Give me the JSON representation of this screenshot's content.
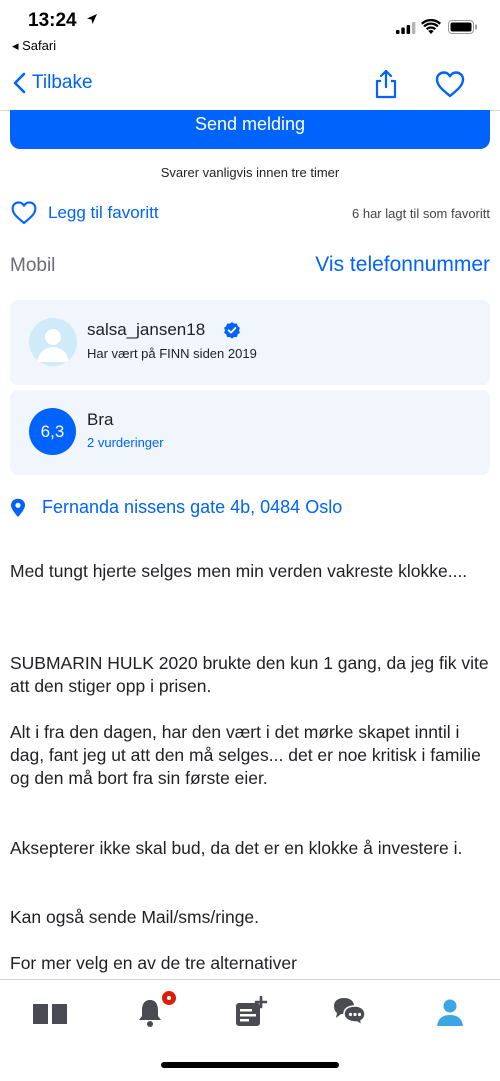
{
  "status": {
    "time": "13:24",
    "back_app": "◂ Safari"
  },
  "nav": {
    "back_label": "Tilbake"
  },
  "contact": {
    "send_label": "Send melding",
    "reply_note": "Svarer vanligvis innen tre timer",
    "favorite_label": "Legg til favoritt",
    "favorite_count": "6 har lagt til som favoritt",
    "phone_label": "Mobil",
    "phone_link": "Vis telefonnummer"
  },
  "seller": {
    "username": "salsa_jansen18",
    "since": "Har vært på FINN siden 2019",
    "score": "6,3",
    "rating_label": "Bra",
    "rating_count": "2 vurderinger"
  },
  "address": "Fernanda nissens gate 4b, 0484 Oslo",
  "description": [
    "Med tungt hjerte selges men min verden vakreste klokke....",
    "SUBMARIN HULK 2020 brukte den kun 1 gang, da jeg fik vite att den stiger opp i prisen.",
    "Alt i fra den dagen, har den vært i det mørke skapet inntil i dag, fant jeg ut att den må selges... det er noe kritisk i familie og den må bort fra sin første eier.",
    "Aksepterer ikke skal bud, da det er en klokke å investere i.",
    "Kan også sende Mail/sms/ringe.",
    "For mer velg en av de tre alternativer"
  ],
  "tabs": [
    {
      "icon": "book-icon"
    },
    {
      "icon": "bell-icon",
      "badge": true
    },
    {
      "icon": "new-ad-icon"
    },
    {
      "icon": "chat-icon"
    },
    {
      "icon": "profile-icon",
      "active": true
    }
  ],
  "colors": {
    "accent": "#0063fb",
    "card": "#f1f6fc",
    "badge": "#d91f0a",
    "tab_icon": "#4a4a52",
    "tab_active": "#3aa7e3"
  }
}
